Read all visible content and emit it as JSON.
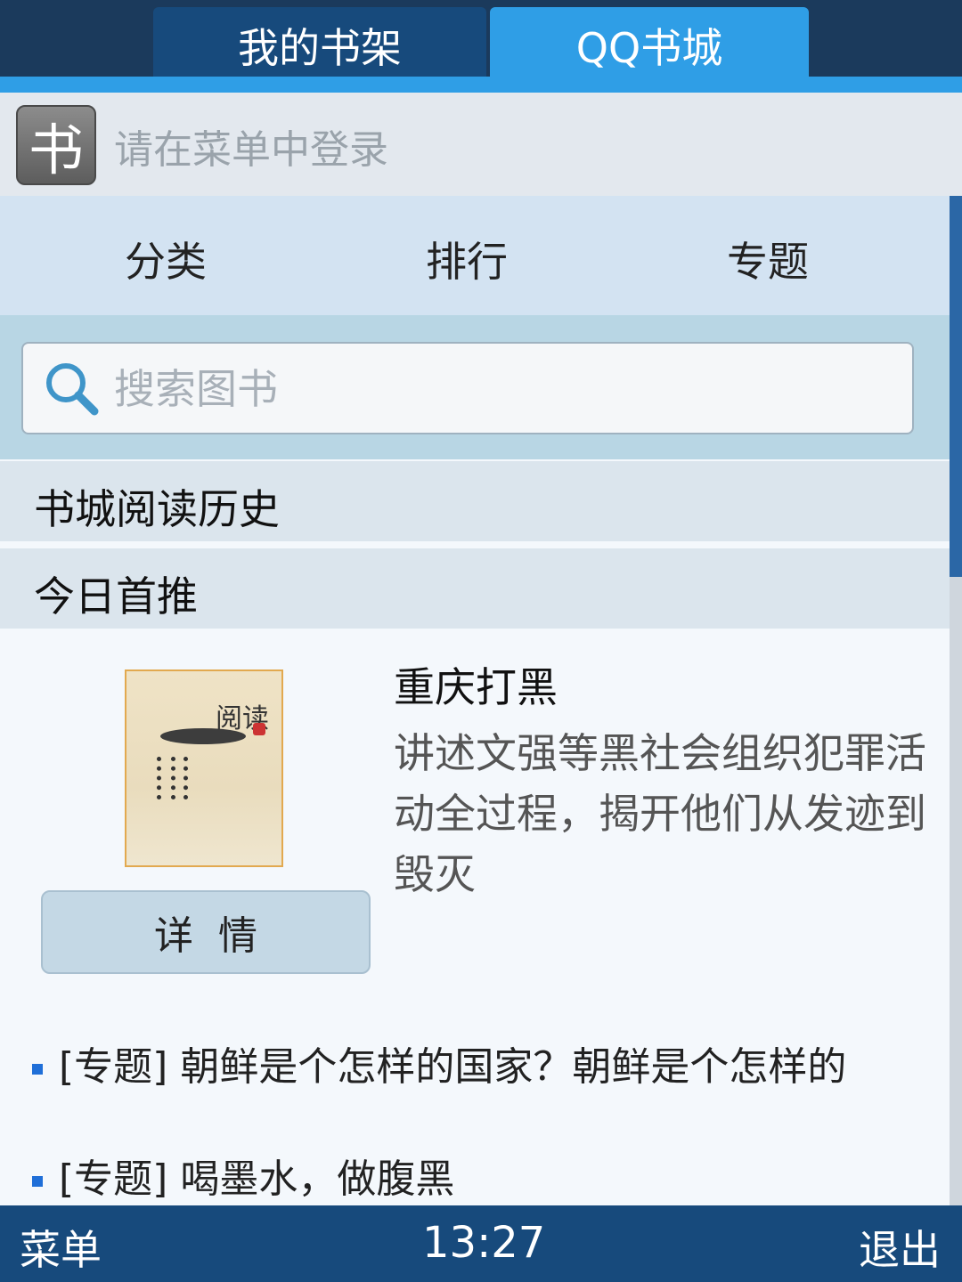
{
  "tabs": [
    {
      "label": "我的书架",
      "active": false
    },
    {
      "label": "QQ书城",
      "active": true
    }
  ],
  "login": {
    "logo_char": "书",
    "text": "请在菜单中登录"
  },
  "category_nav": [
    "分类",
    "排行",
    "专题"
  ],
  "search": {
    "placeholder": "搜索图书",
    "icon": "search-icon"
  },
  "rows": {
    "history": "书城阅读历史",
    "today_pick": "今日首推"
  },
  "featured_book": {
    "cover_art_text": "阅读",
    "title": "重庆打黑",
    "description": "讲述文强等黑社会组织犯罪活动全过程，揭开他们从发迹到毁灭",
    "detail_button": "详情"
  },
  "topics": [
    "[专题] 朝鲜是个怎样的国家？朝鲜是个怎样的",
    "[专题] 喝墨水，做腹黑"
  ],
  "bottom_bar": {
    "menu": "菜单",
    "time": "13:27",
    "exit": "退出"
  },
  "colors": {
    "header": "#1b3a5c",
    "active_tab": "#2f9ee6",
    "bottom_bar": "#174a7c",
    "bullet": "#1f6fd8"
  }
}
